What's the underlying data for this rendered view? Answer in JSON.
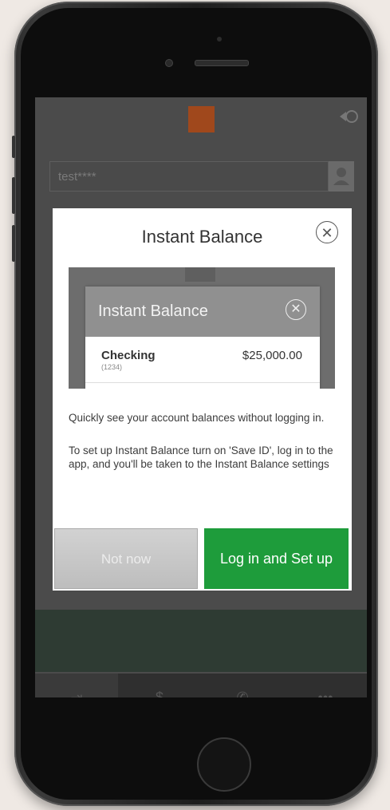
{
  "background": {
    "user_id_masked": "test****"
  },
  "modal": {
    "title": "Instant Balance",
    "preview": {
      "title": "Instant Balance",
      "account_name": "Checking",
      "account_number": "(1234)",
      "balance": "$25,000.00"
    },
    "paragraph1": "Quickly see your account balances without logging in.",
    "paragraph2": "To set up Instant Balance turn on 'Save ID', log in to the app, and you'll be taken to the Instant Balance settings",
    "secondary_button": "Not now",
    "primary_button": "Log in and Set up"
  },
  "colors": {
    "primary": "#1e9c3b",
    "brand": "#a0481c"
  },
  "icons": [
    "close-icon",
    "user-icon",
    "signin-icon",
    "dollar-icon",
    "phone-icon",
    "more-icon"
  ]
}
